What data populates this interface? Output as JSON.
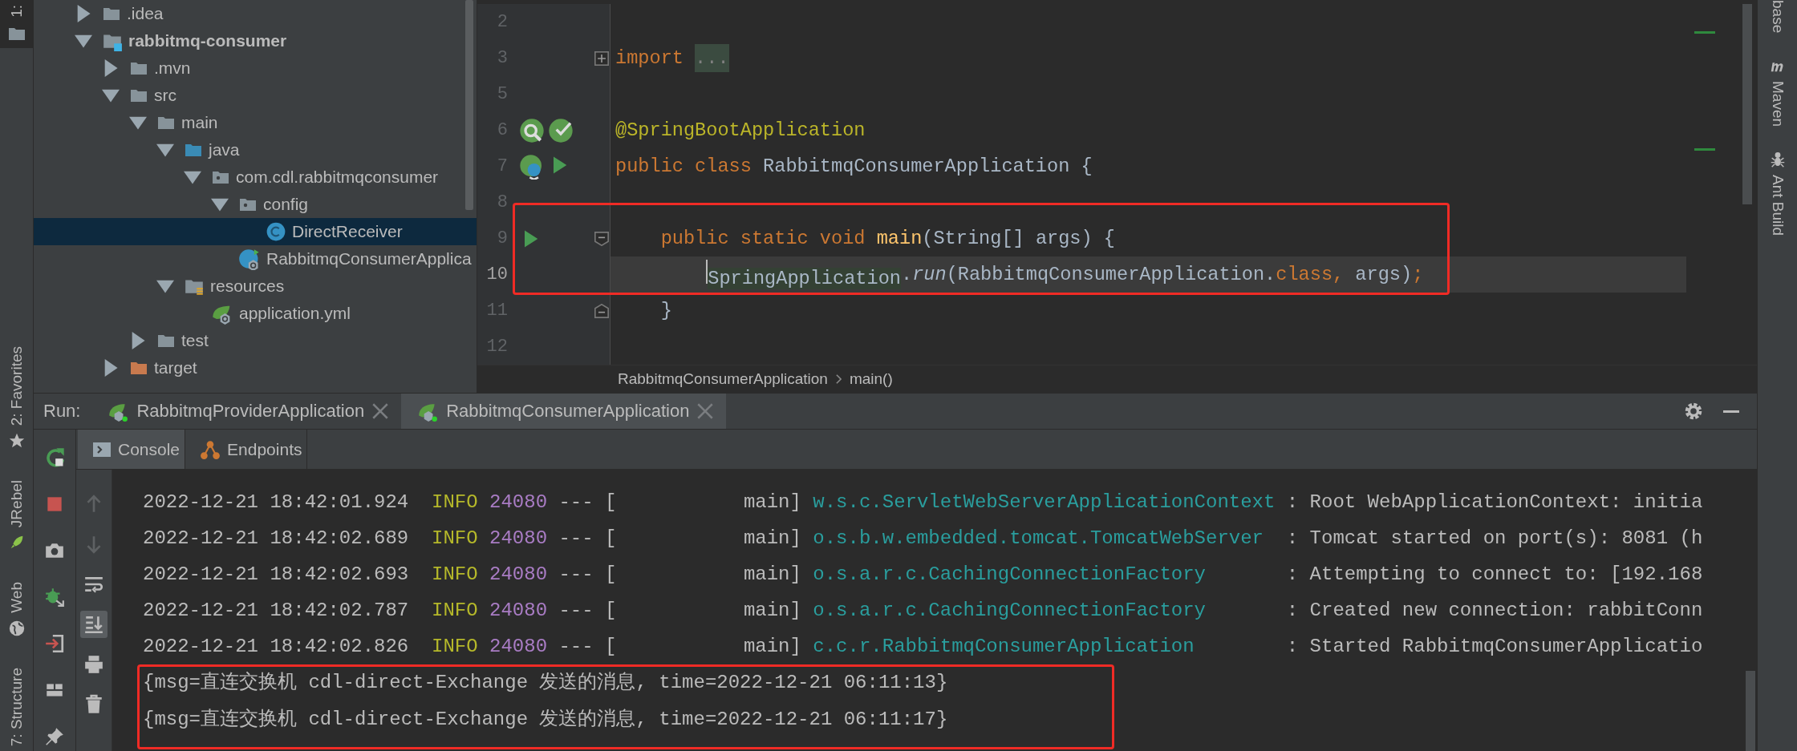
{
  "left_stripe": {
    "tabs": [
      {
        "label": "1:",
        "kind": "folder",
        "selected": true
      },
      {
        "label": "2: Favorites",
        "kind": "star",
        "selected": false
      },
      {
        "label": "JRebel",
        "kind": "jrebel",
        "selected": false
      },
      {
        "label": "Web",
        "kind": "globe",
        "selected": false
      },
      {
        "label": "7: Structure",
        "kind": "plain",
        "selected": false
      }
    ]
  },
  "project_tree": {
    "items": [
      {
        "label": ".idea",
        "kind": "folder",
        "expanded": false,
        "selected": false
      },
      {
        "label": "rabbitmq-consumer",
        "kind": "module",
        "expanded": true,
        "selected": false,
        "children": [
          {
            "label": ".mvn",
            "kind": "folder",
            "expanded": false,
            "selected": false
          },
          {
            "label": "src",
            "kind": "folder",
            "expanded": true,
            "selected": false,
            "children": [
              {
                "label": "main",
                "kind": "folder",
                "expanded": true,
                "selected": false,
                "children": [
                  {
                    "label": "java",
                    "kind": "source",
                    "expanded": true,
                    "selected": false,
                    "children": [
                      {
                        "label": "com.cdl.rabbitmqconsumer",
                        "kind": "package",
                        "expanded": true,
                        "selected": false,
                        "children": [
                          {
                            "label": "config",
                            "kind": "package",
                            "expanded": true,
                            "selected": false,
                            "children": [
                              {
                                "label": "DirectReceiver",
                                "kind": "class",
                                "selected": true
                              }
                            ]
                          },
                          {
                            "label": "RabbitmqConsumerApplica",
                            "kind": "spring-class",
                            "selected": false
                          }
                        ]
                      }
                    ]
                  },
                  {
                    "label": "resources",
                    "kind": "resources",
                    "expanded": true,
                    "selected": false,
                    "children": [
                      {
                        "label": "application.yml",
                        "kind": "yml",
                        "selected": false
                      }
                    ]
                  }
                ]
              },
              {
                "label": "test",
                "kind": "folder",
                "expanded": false,
                "selected": false
              }
            ]
          },
          {
            "label": "target",
            "kind": "excluded",
            "expanded": false,
            "selected": false
          }
        ]
      }
    ]
  },
  "editor": {
    "lines": [
      {
        "number": "2",
        "current": false
      },
      {
        "number": "3",
        "current": false,
        "fold": {
          "kind": "expand"
        },
        "tokens": [
          {
            "kind": "keyword",
            "text": "import"
          },
          {
            "kind": "folded",
            "text": "..."
          }
        ]
      },
      {
        "number": "5",
        "current": false
      },
      {
        "number": "6",
        "current": false,
        "gutter": [
          {
            "kind": "bean-search"
          },
          {
            "kind": "bean-check"
          }
        ],
        "tokens": [
          {
            "kind": "annotation",
            "text": "@SpringBootApplication"
          }
        ]
      },
      {
        "number": "7",
        "current": false,
        "gutter": [
          {
            "kind": "bean"
          },
          {
            "kind": "run"
          }
        ],
        "tokens": [
          {
            "kind": "keyword",
            "text": "public class"
          },
          {
            "kind": "plain",
            "text": " RabbitmqConsumerApplication {"
          }
        ]
      },
      {
        "number": "8",
        "current": false
      },
      {
        "number": "9",
        "current": false,
        "gutter": [
          {
            "kind": "run"
          }
        ],
        "fold": {
          "kind": "collapse"
        },
        "tokens": [
          {
            "kind": "keyword",
            "text": "    public static void"
          },
          {
            "kind": "method",
            "text": " main"
          },
          {
            "kind": "plain",
            "text": "(String[] args) {"
          }
        ]
      },
      {
        "number": "10",
        "current": true,
        "tokens": [
          {
            "kind": "usage",
            "text": "        SpringApplication",
            "caret": true
          },
          {
            "kind": "plain",
            "text": "."
          },
          {
            "kind": "static",
            "text": "run"
          },
          {
            "kind": "plain",
            "text": "(RabbitmqConsumerApplication."
          },
          {
            "kind": "keyword",
            "text": "class,"
          },
          {
            "kind": "plain",
            "text": " args)"
          },
          {
            "kind": "keyword",
            "text": ";"
          }
        ]
      },
      {
        "number": "11",
        "current": false,
        "fold": {
          "kind": "end"
        },
        "tokens": [
          {
            "kind": "plain",
            "text": "    }"
          }
        ]
      },
      {
        "number": "12",
        "current": false
      }
    ],
    "breadcrumbs": [
      "RabbitmqConsumerApplication",
      "main()"
    ]
  },
  "right_stripe": {
    "tabs": [
      {
        "label": "base",
        "kind": "plain"
      },
      {
        "label": "Maven",
        "kind": "maven"
      },
      {
        "label": "Ant Build",
        "kind": "ant"
      }
    ]
  },
  "run": {
    "label": "Run:",
    "tabs": [
      {
        "label": "RabbitmqProviderApplication",
        "selected": false
      },
      {
        "label": "RabbitmqConsumerApplication",
        "selected": true
      }
    ],
    "toolbar": [
      {
        "kind": "rerun"
      },
      {
        "kind": "stop"
      },
      {
        "kind": "camera"
      },
      {
        "kind": "debug"
      },
      {
        "kind": "exit"
      },
      {
        "kind": "layout"
      },
      {
        "kind": "pin"
      }
    ],
    "console_toolbar": [
      {
        "kind": "up",
        "disabled": true,
        "selected": false
      },
      {
        "kind": "down",
        "disabled": true,
        "selected": false
      },
      {
        "kind": "wrap",
        "disabled": false,
        "selected": false
      },
      {
        "kind": "scroll-end",
        "disabled": false,
        "selected": true
      },
      {
        "kind": "print",
        "disabled": false,
        "selected": false
      },
      {
        "kind": "trash",
        "disabled": false,
        "selected": false
      }
    ],
    "subtabs": [
      {
        "label": "Console",
        "kind": "console",
        "selected": true
      },
      {
        "label": "Endpoints",
        "kind": "endpoints",
        "selected": false
      }
    ],
    "console": {
      "lines": [
        {
          "kind": "log",
          "time": "2022-12-21 18:42:01.924",
          "level": "INFO",
          "pid": "24080",
          "thread": "--- [           main]",
          "logger": "w.s.c.ServletWebServerApplicationContext",
          "message": ": Root WebApplicationContext: initia"
        },
        {
          "kind": "log",
          "time": "2022-12-21 18:42:02.689",
          "level": "INFO",
          "pid": "24080",
          "thread": "--- [           main]",
          "logger": "o.s.b.w.embedded.tomcat.TomcatWebServer",
          "message": ": Tomcat started on port(s): 8081 (h"
        },
        {
          "kind": "log",
          "time": "2022-12-21 18:42:02.693",
          "level": "INFO",
          "pid": "24080",
          "thread": "--- [           main]",
          "logger": "o.s.a.r.c.CachingConnectionFactory",
          "message": ": Attempting to connect to: [192.168"
        },
        {
          "kind": "log",
          "time": "2022-12-21 18:42:02.787",
          "level": "INFO",
          "pid": "24080",
          "thread": "--- [           main]",
          "logger": "o.s.a.r.c.CachingConnectionFactory",
          "message": ": Created new connection: rabbitConn"
        },
        {
          "kind": "log",
          "time": "2022-12-21 18:42:02.826",
          "level": "INFO",
          "pid": "24080",
          "thread": "--- [           main]",
          "logger": "c.c.r.RabbitmqConsumerApplication",
          "message": ": Started RabbitmqConsumerApplicatio"
        },
        {
          "kind": "output",
          "text": "{msg=直连交换机 cdl-direct-Exchange 发送的消息, time=2022-12-21 06:11:13}"
        },
        {
          "kind": "output",
          "text": "{msg=直连交换机 cdl-direct-Exchange 发送的消息, time=2022-12-21 06:11:17}"
        }
      ]
    }
  }
}
